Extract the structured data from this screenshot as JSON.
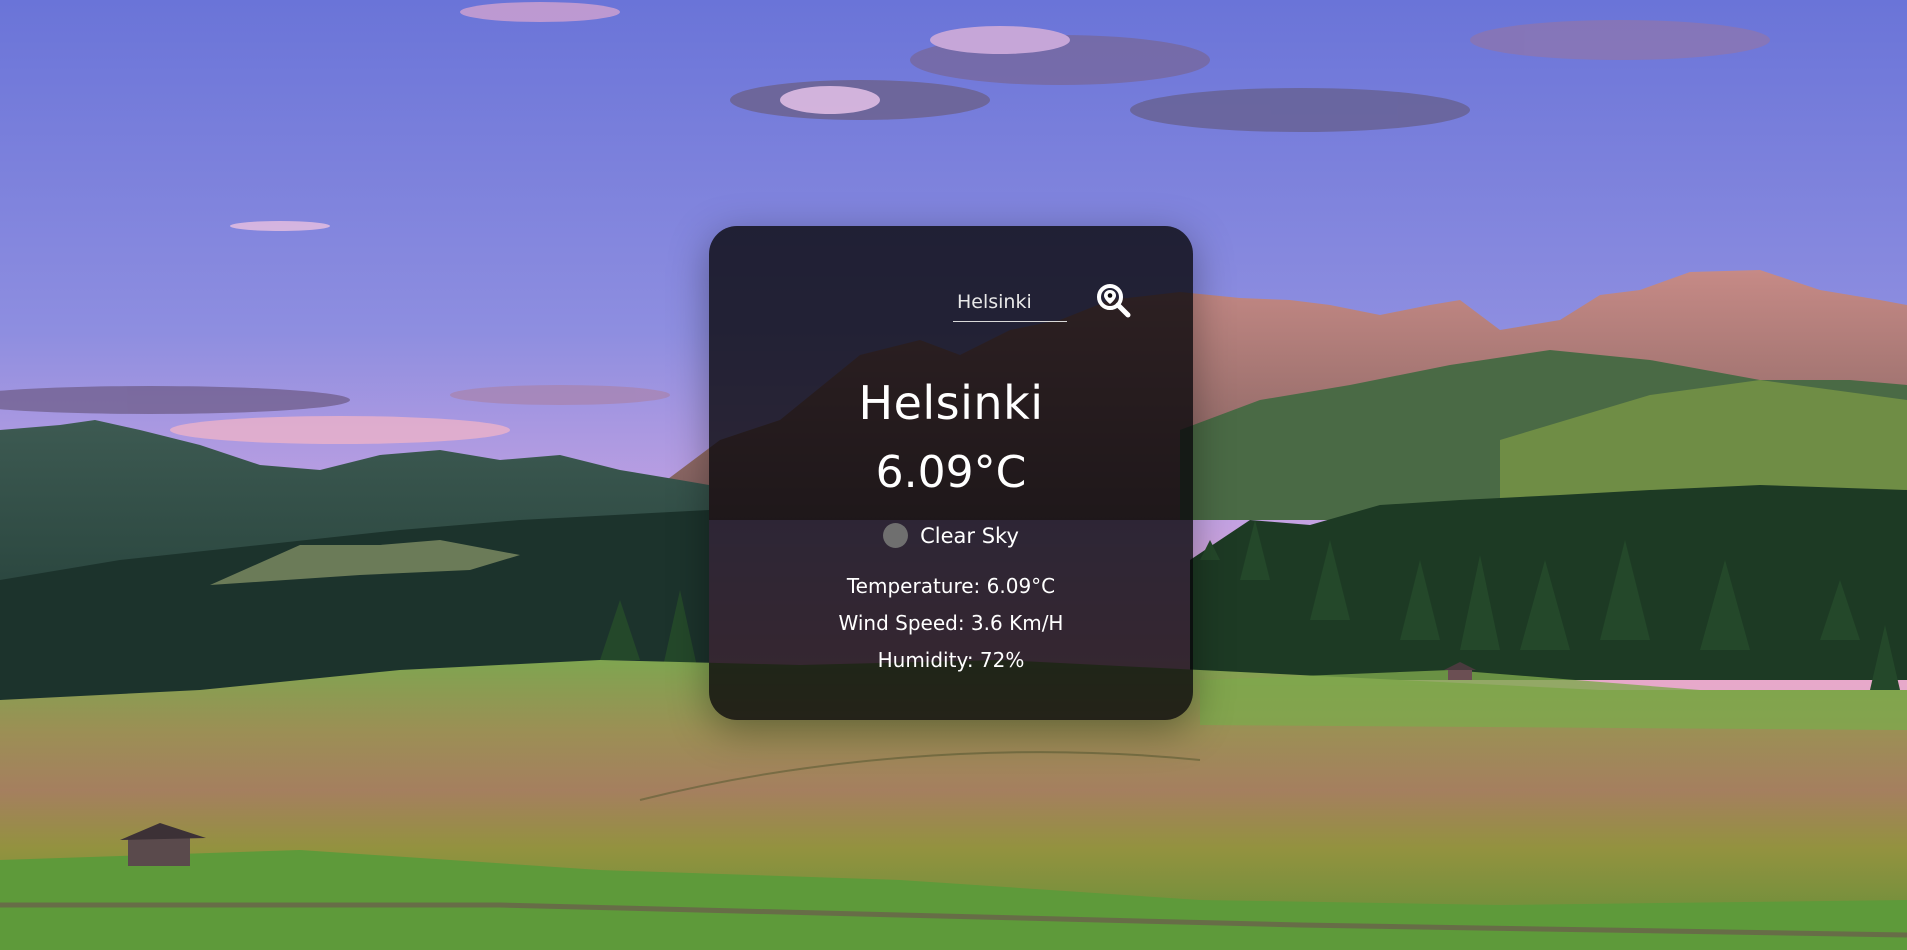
{
  "search": {
    "value": "Helsinki",
    "placeholder": "Helsinki",
    "button_icon": "search-location-icon"
  },
  "weather": {
    "city": "Helsinki",
    "temperature": "6.09°C",
    "condition": "Clear Sky",
    "condition_icon": "weather-condition-icon",
    "details": {
      "temperature": "Temperature: 6.09°C",
      "wind_speed": "Wind Speed: 3.6 Km/H",
      "humidity": "Humidity: 72%"
    }
  },
  "colors": {
    "card_background": "#08060a",
    "text": "#ffffff",
    "sky_top": "#6d6fd6",
    "sky_bottom": "#d79dd6",
    "grass": "#6a8f3f"
  }
}
